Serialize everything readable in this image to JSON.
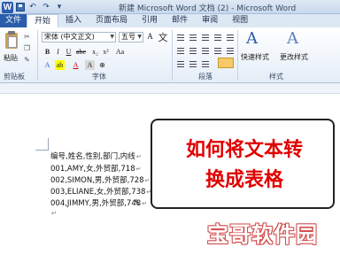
{
  "window": {
    "title": "新建 Microsoft Word 文档 (2) - Microsoft Word",
    "logo_letter": "W"
  },
  "tabs": {
    "file": "文件",
    "items": [
      "开始",
      "插入",
      "页面布局",
      "引用",
      "邮件",
      "审阅",
      "视图"
    ],
    "active": "开始"
  },
  "ribbon": {
    "clipboard": {
      "paste_label": "粘贴",
      "group_label": "剪贴板"
    },
    "font": {
      "font_name": "宋体 (中文正文)",
      "font_size": "五号",
      "group_label": "字体",
      "bold": "B",
      "italic": "I",
      "underline": "U",
      "grow": "A",
      "shrink": "A",
      "clear": "Aa",
      "wen": "文"
    },
    "paragraph": {
      "group_label": "段落"
    },
    "styles": {
      "quick_styles_label": "快速样式",
      "change_styles_label": "更改样式",
      "group_label": "样式",
      "glyph": "A"
    }
  },
  "document": {
    "lines": [
      "编号,姓名,性别,部门,内线",
      "001,AMY,女,外贸部,718",
      "002,SIMON,男,外贸部,728",
      "003,ELIANE,女,外贸部,738",
      "004,JIMMY,男,外贸部,748"
    ],
    "paragraph_mark": "↵"
  },
  "callout": {
    "line1": "如何将文本转",
    "line2": "换成表格"
  },
  "watermark": {
    "text": "宝哥软件园"
  },
  "colors": {
    "accent": "#2a5dab",
    "callout_text": "#e00000"
  }
}
